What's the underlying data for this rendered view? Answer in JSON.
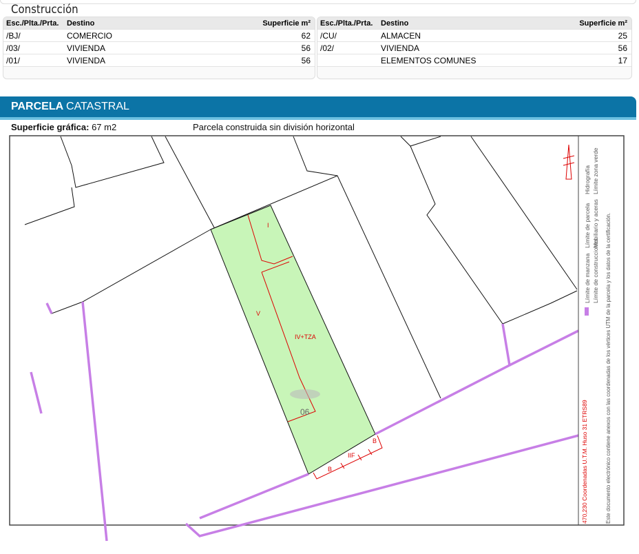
{
  "construccion": {
    "title": "Construcción",
    "headers": {
      "esc": "Esc./Plta./Prta.",
      "destino": "Destino",
      "superficie": "Superficie m²"
    },
    "left": [
      {
        "esc": "/BJ/",
        "destino": "COMERCIO",
        "sup": "62"
      },
      {
        "esc": "/03/",
        "destino": "VIVIENDA",
        "sup": "56"
      },
      {
        "esc": "/01/",
        "destino": "VIVIENDA",
        "sup": "56"
      }
    ],
    "right": [
      {
        "esc": "/CU/",
        "destino": "ALMACEN",
        "sup": "25"
      },
      {
        "esc": "/02/",
        "destino": "VIVIENDA",
        "sup": "56"
      },
      {
        "esc": "",
        "destino": "ELEMENTOS COMUNES",
        "sup": "17"
      }
    ]
  },
  "parcela": {
    "title_bold": "PARCELA",
    "title_light": "CATASTRAL",
    "superficie_label": "Superficie gráfica:",
    "superficie_value": "67 m2",
    "descripcion": "Parcela construida sin división horizontal"
  },
  "map": {
    "labels": {
      "i": "I",
      "v": "V",
      "ivtza": "IV+TZA",
      "num": "06",
      "iif": "IIF",
      "b1": "B",
      "b2": "B"
    },
    "coords": "470,230 Coordenadas U.T.M. Huso 31 ETRS89",
    "legend": [
      "Límite de manzana",
      "Límite de construcciones",
      "Límite de parcela",
      "Mobiliario y aceras",
      "Hidrografía",
      "Límite zona verde"
    ],
    "note": "Este documento electrónico contiene anexos con las coordenadas de los vértices UTM de la parcela y los datos de la certificación.",
    "colors": {
      "parcel": "#c8f5b8",
      "manzana": "#c77fe6",
      "construccion": "#dd0000"
    }
  }
}
